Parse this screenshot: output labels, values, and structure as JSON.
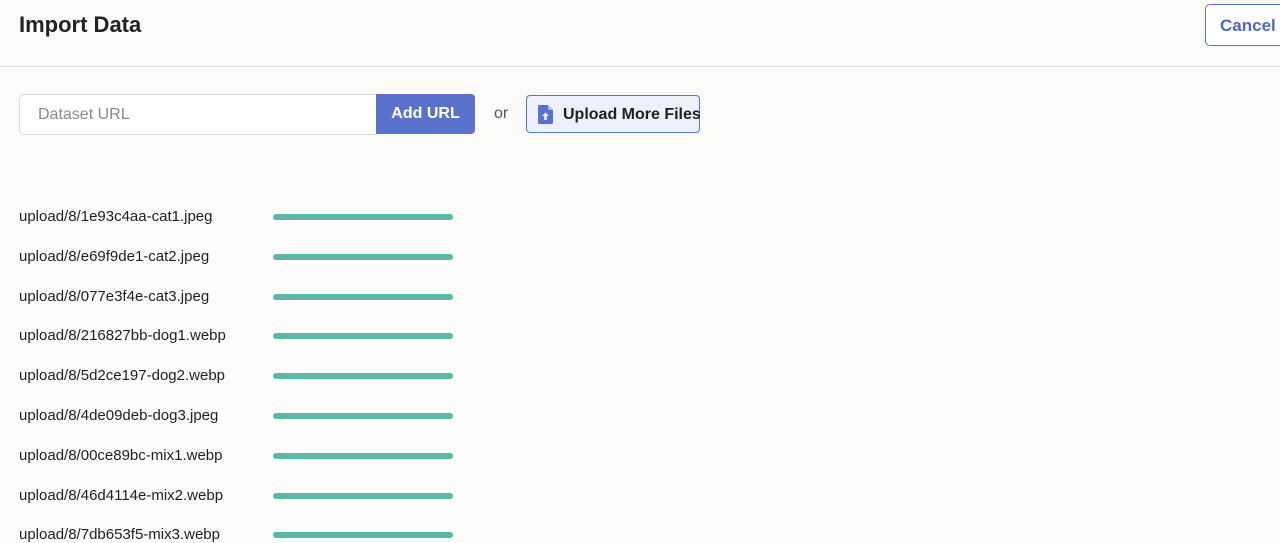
{
  "header": {
    "title": "Import Data",
    "cancel_label": "Cancel"
  },
  "toolbar": {
    "url_placeholder": "Dataset URL",
    "url_value": "",
    "add_url_label": "Add URL",
    "or_label": "or",
    "upload_label": "Upload More Files",
    "upload_icon": "file-upload-icon"
  },
  "colors": {
    "accent": "#5b72cd",
    "progress": "#5bb8a8"
  },
  "files": [
    {
      "name": "upload/8/1e93c4aa-cat1.jpeg",
      "progress": 1.0
    },
    {
      "name": "upload/8/e69f9de1-cat2.jpeg",
      "progress": 1.0
    },
    {
      "name": "upload/8/077e3f4e-cat3.jpeg",
      "progress": 1.0
    },
    {
      "name": "upload/8/216827bb-dog1.webp",
      "progress": 1.0
    },
    {
      "name": "upload/8/5d2ce197-dog2.webp",
      "progress": 1.0
    },
    {
      "name": "upload/8/4de09deb-dog3.jpeg",
      "progress": 1.0
    },
    {
      "name": "upload/8/00ce89bc-mix1.webp",
      "progress": 1.0
    },
    {
      "name": "upload/8/46d4114e-mix2.webp",
      "progress": 1.0
    },
    {
      "name": "upload/8/7db653f5-mix3.webp",
      "progress": 1.0
    }
  ]
}
